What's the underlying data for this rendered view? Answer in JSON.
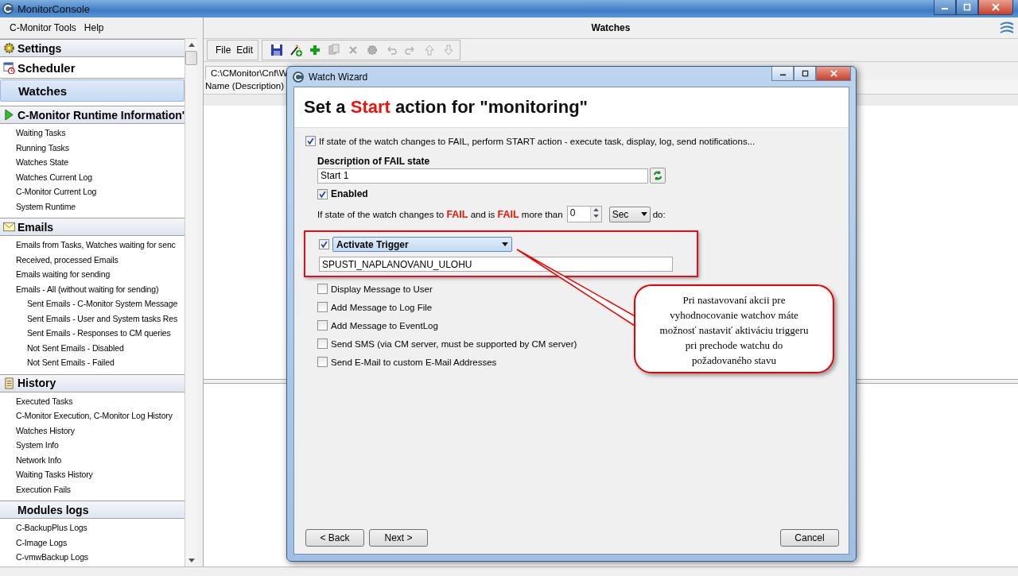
{
  "window": {
    "title": "MonitorConsole"
  },
  "menu": [
    "C-Monitor Tools",
    "Help"
  ],
  "sidebar": {
    "groups": [
      {
        "title": "Settings",
        "kind": "band",
        "selected": false
      },
      {
        "title": "Scheduler",
        "kind": "plain",
        "selected": false
      },
      {
        "title": "Watches",
        "kind": "plain",
        "selected": true
      },
      {
        "title": "C-Monitor Runtime Information'",
        "kind": "band",
        "selected": false,
        "items": [
          {
            "label": "Waiting Tasks"
          },
          {
            "label": "Running Tasks"
          },
          {
            "label": "Watches State"
          },
          {
            "label": "Watches Current Log"
          },
          {
            "label": "C-Monitor Current Log"
          },
          {
            "label": "System Runtime"
          }
        ]
      },
      {
        "title": "Emails",
        "kind": "band",
        "selected": false,
        "items": [
          {
            "label": "Emails from Tasks, Watches waiting for senc"
          },
          {
            "label": "Received, processed Emails"
          },
          {
            "label": "Emails waiting for sending"
          },
          {
            "label": "Emails - All (without waiting for sending)",
            "children": [
              {
                "label": "Sent Emails - C-Monitor System Message"
              },
              {
                "label": "Sent Emails - User and System tasks Res"
              },
              {
                "label": "Sent Emails - Responses to CM queries"
              },
              {
                "label": "Not Sent Emails - Disabled"
              },
              {
                "label": "Not Sent Emails - Failed"
              }
            ]
          }
        ]
      },
      {
        "title": "History",
        "kind": "band",
        "selected": false,
        "items": [
          {
            "label": "Executed Tasks"
          },
          {
            "label": "C-Monitor Execution, C-Monitor Log History"
          },
          {
            "label": "Watches History"
          },
          {
            "label": "System Info"
          },
          {
            "label": "Network Info"
          },
          {
            "label": "Waiting Tasks History"
          },
          {
            "label": "Execution Fails"
          }
        ]
      },
      {
        "title": "Modules logs",
        "kind": "band",
        "selected": false,
        "items": [
          {
            "label": "C-BackupPlus Logs"
          },
          {
            "label": "C-Image Logs"
          },
          {
            "label": "C-vmwBackup Logs"
          }
        ]
      }
    ]
  },
  "main": {
    "title": "Watches",
    "menu": [
      "File",
      "Edit"
    ],
    "toolbar": [
      {
        "disabled": false
      },
      {
        "disabled": false
      },
      {
        "disabled": false
      },
      {
        "disabled": true
      },
      {
        "disabled": true
      },
      {
        "disabled": true
      },
      {
        "disabled": true
      },
      {
        "disabled": true
      },
      {
        "disabled": true
      },
      {
        "disabled": true
      }
    ],
    "path_tab": "C:\\CMonitor\\Cnf\\W",
    "columns": [
      "Name (Description)"
    ]
  },
  "dialog": {
    "title": "Watch Wizard",
    "heading": "Set a **Start** action for \"monitoring\"",
    "perform": {
      "label": "If state of the watch changes to FAIL, perform START action - execute task, display, log, send notifications...",
      "checked": true
    },
    "description": {
      "label": "Description of FAIL state",
      "value": "Start 1"
    },
    "enabled": {
      "label": "Enabled",
      "checked": true
    },
    "condition": {
      "text": "If state of the watch changes to **FAIL** and is **FAIL** more than",
      "value": "0",
      "unit": "Sec",
      "suffix": "do:"
    },
    "trigger": {
      "checked": true,
      "action": "Activate Trigger",
      "value": "SPUSTI_NAPLANOVANU_ULOHU"
    },
    "options": [
      {
        "label": "Display Message to User",
        "checked": false
      },
      {
        "label": "Add Message to Log File",
        "checked": false
      },
      {
        "label": "Add Message to EventLog",
        "checked": false
      },
      {
        "label": "Send SMS (via CM server, must be supported by CM server)",
        "checked": false
      },
      {
        "label": "Send E-Mail to custom E-Mail Addresses",
        "checked": false
      }
    ],
    "buttons": [
      "< Back",
      "Next >",
      "Cancel"
    ]
  },
  "callout": "Pri nastavovaní akcii pre vyhodnocovanie watchov máte možnosť nastaviť aktiváciu triggeru pri prechode watchu do požadovaného stavu"
}
